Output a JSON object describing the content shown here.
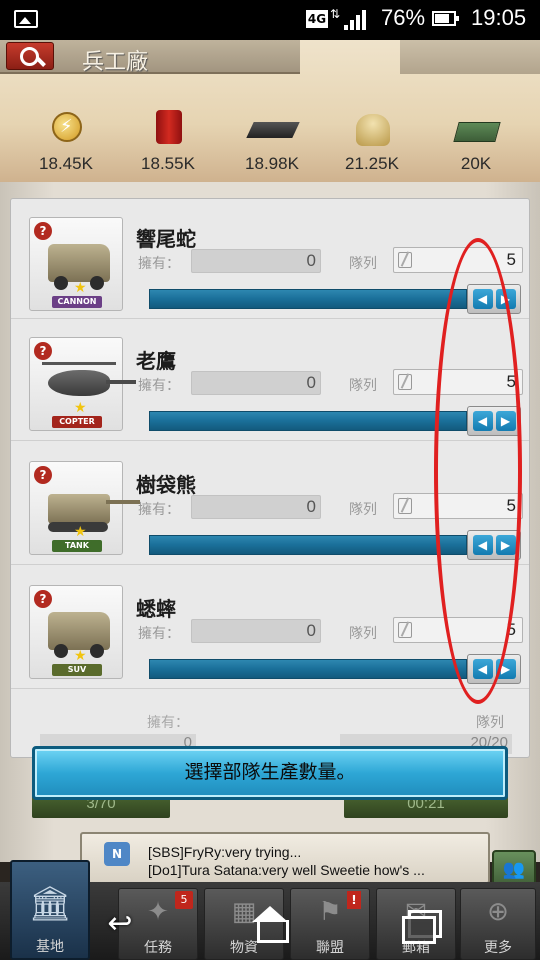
{
  "status_bar": {
    "network": "4G",
    "battery_percent": "76%",
    "time": "19:05"
  },
  "header": {
    "title": "兵工廠"
  },
  "resources": [
    {
      "icon": "energy-icon",
      "amount": "18.45K"
    },
    {
      "icon": "fuel-icon",
      "amount": "18.55K"
    },
    {
      "icon": "steel-icon",
      "amount": "18.98K"
    },
    {
      "icon": "sand-icon",
      "amount": "21.25K"
    },
    {
      "icon": "money-icon",
      "amount": "20K"
    }
  ],
  "labels": {
    "owned": "擁有：",
    "queue": "隊列",
    "help": "?"
  },
  "units": [
    {
      "name": "響尾蛇",
      "type_badge": "CANNON",
      "owned": "0",
      "queue": "5"
    },
    {
      "name": "老鷹",
      "type_badge": "COPTER",
      "owned": "0",
      "queue": "5"
    },
    {
      "name": "樹袋熊",
      "type_badge": "TANK",
      "owned": "0",
      "queue": "5"
    },
    {
      "name": "蟋蟀",
      "type_badge": "SUV",
      "owned": "0",
      "queue": "5"
    }
  ],
  "totals": {
    "owned_label": "擁有：",
    "owned_value": "0",
    "queue_label": "隊列",
    "queue_value": "20/20"
  },
  "confirm_button": "選擇部隊生產數量。",
  "sub_buttons": [
    "3/70",
    "00:21"
  ],
  "chat": {
    "icon_label": "N",
    "lines": [
      "[SBS]FryRy:very trying...",
      "[Do1]Tura Satana:very well Sweetie how's ..."
    ]
  },
  "bottom_nav": [
    {
      "label": "基地",
      "icon": "base-icon"
    },
    {
      "label": "任務",
      "icon": "mission-icon",
      "badge": "5"
    },
    {
      "label": "物資",
      "icon": "supplies-icon"
    },
    {
      "label": "聯盟",
      "icon": "alliance-icon",
      "alert": "!"
    },
    {
      "label": "郵箱",
      "icon": "mail-icon"
    },
    {
      "label": "更多",
      "icon": "more-icon"
    }
  ],
  "colors": {
    "slider": "#1a6f99",
    "annotation": "#e02020",
    "confirm": "#2ea7d6"
  }
}
